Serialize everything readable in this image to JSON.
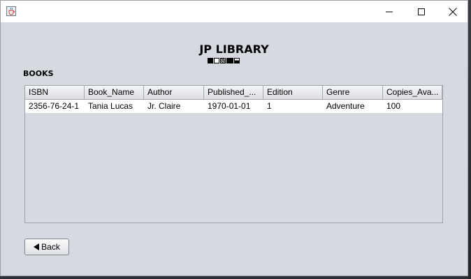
{
  "window": {
    "icon": "java-cup-icon",
    "controls": [
      "minimize-icon",
      "maximize-icon",
      "close-icon"
    ]
  },
  "header": {
    "title": "JP LIBRARY",
    "subtitle_glyphs": "■□▒■▪"
  },
  "section": {
    "label": "BOOKS"
  },
  "table": {
    "columns": [
      "ISBN",
      "Book_Name",
      "Author",
      "Published_...",
      "Edition",
      "Genre",
      "Copies_Ava..."
    ],
    "rows": [
      [
        "2356-76-24-1",
        "Tania Lucas",
        "Jr. Claire",
        "1970-01-01",
        "1",
        "Adventure",
        "100"
      ]
    ]
  },
  "actions": {
    "back_label": "Back"
  },
  "colors": {
    "window_bg": "#d6d9df",
    "titlebar_bg": "#ffffff",
    "row_bg": "#ffffff"
  }
}
